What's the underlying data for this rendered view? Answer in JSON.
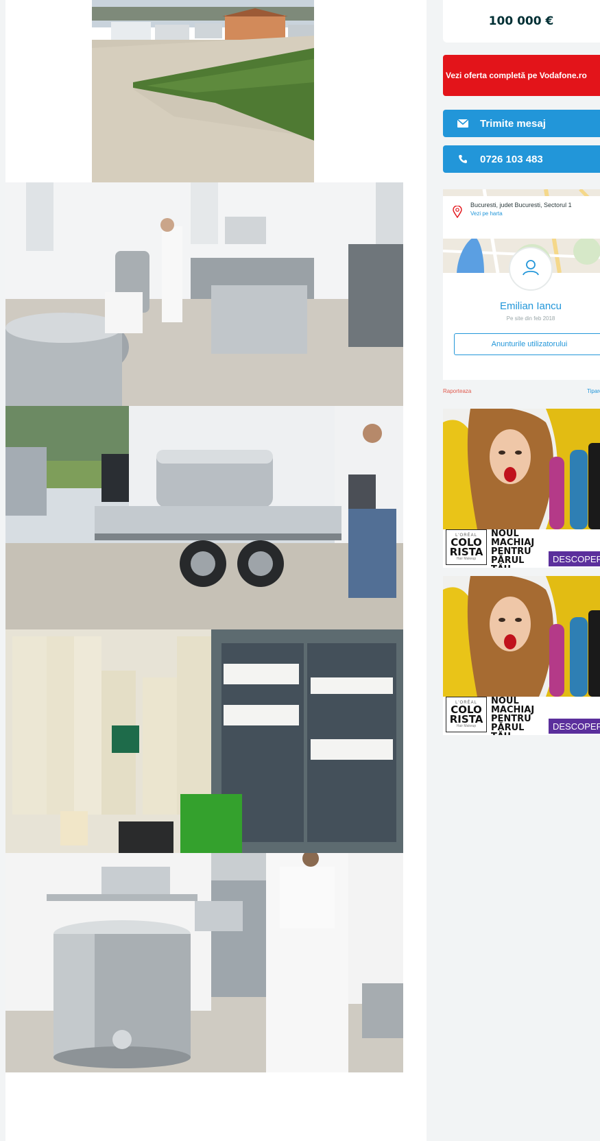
{
  "listing": {
    "price": "100 000 €"
  },
  "actions": {
    "vodafone_offer": "Vezi oferta completă pe Vodafone.ro",
    "send_message": "Trimite mesaj",
    "phone": "0726 103 483"
  },
  "location": {
    "address": "Bucuresti, judet Bucuresti, Sectorul 1",
    "map_link": "Vezi pe harta"
  },
  "seller": {
    "name": "Emilian Iancu",
    "member_since": "Pe site din feb 2018",
    "user_ads_button": "Anunturile utilizatorului"
  },
  "footer_links": {
    "report": "Raporteaza",
    "print": "Tipareste"
  },
  "ads": [
    {
      "brand": "L'ORÉAL",
      "logo": "COLO RISTA",
      "logo_sub": "Hair Makeup",
      "headline": "NOUL MACHIAJ PENTRU PĂRUL TĂU",
      "cta": "DESCOPERĂ"
    },
    {
      "brand": "L'ORÉAL",
      "logo": "COLO RISTA",
      "logo_sub": "Hair Makeup",
      "headline": "NOUL MACHIAJ PENTRU PĂRUL TĂU",
      "cta": "DESCOPERĂ"
    }
  ],
  "colors": {
    "primary_blue": "#2296d9",
    "offer_red": "#e3141a",
    "price_text": "#002f34",
    "ad_purple": "#5b2f9c"
  },
  "icons": {
    "message": "envelope-icon",
    "phone": "phone-icon",
    "location": "map-pin-icon",
    "avatar": "user-icon"
  }
}
